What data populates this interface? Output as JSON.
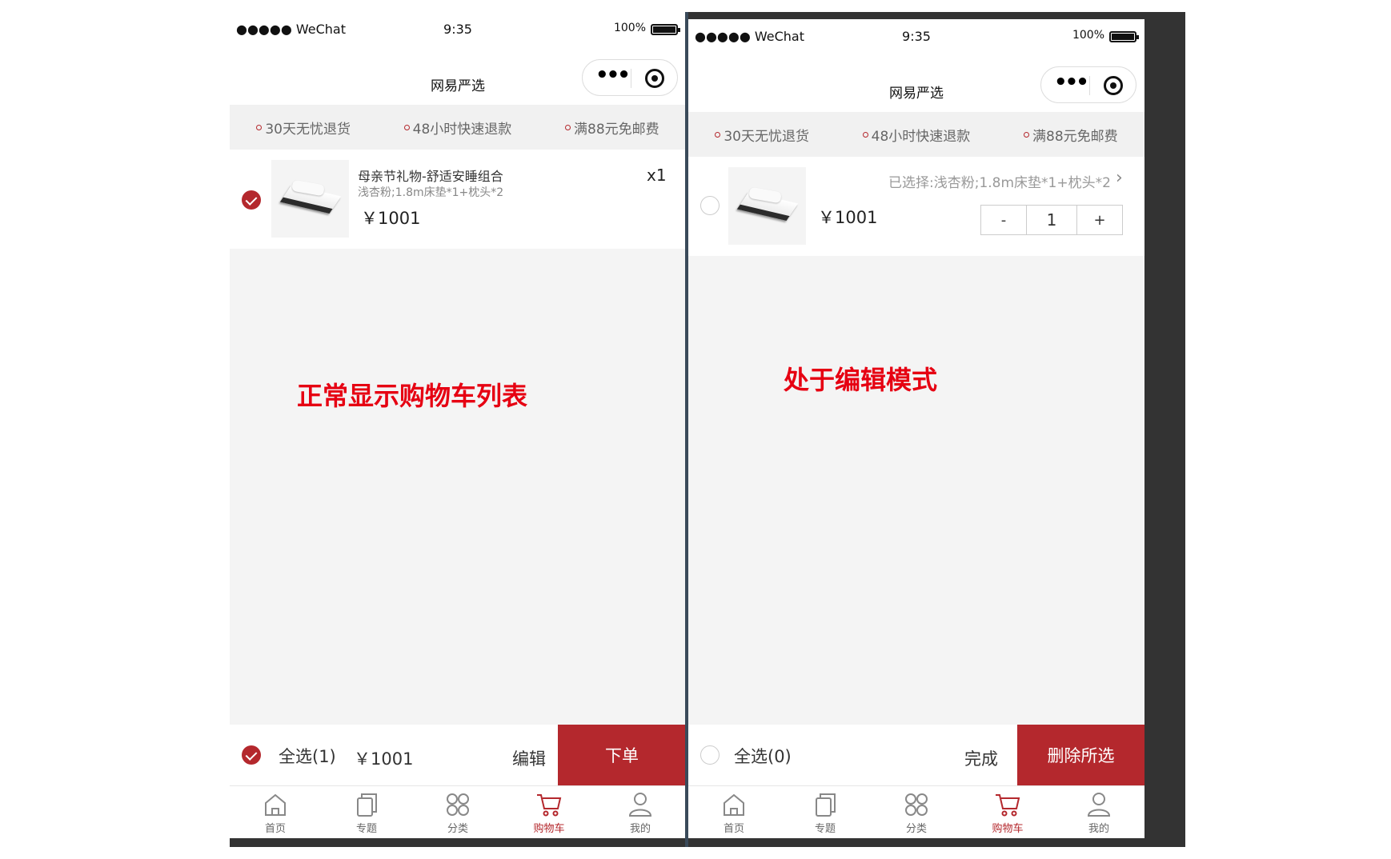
{
  "status_bar": {
    "carrier": "●●●●● WeChat",
    "time": "9:35",
    "battery": "100%"
  },
  "nav": {
    "title": "网易严选"
  },
  "services": [
    "30天无忧退货",
    "48小时快速退款",
    "满88元免邮费"
  ],
  "left": {
    "item": {
      "name": "母亲节礼物-舒适安睡组合",
      "spec": "浅杏粉;1.8m床垫*1+枕头*2",
      "price": "￥1001",
      "qty": "x1",
      "checked": true
    },
    "annotation": "正常显示购物车列表",
    "footer": {
      "select_all": "全选(1)",
      "total": "￥1001",
      "edit": "编辑",
      "action": "下单"
    }
  },
  "right": {
    "item": {
      "spec": "已选择:浅杏粉;1.8m床垫*1+枕头*2",
      "price": "￥1001",
      "stepper": {
        "minus": "-",
        "value": "1",
        "plus": "+"
      },
      "checked": false
    },
    "annotation": "处于编辑模式",
    "footer": {
      "select_all": "全选(0)",
      "done": "完成",
      "action": "删除所选"
    }
  },
  "tabs": [
    {
      "label": "首页",
      "icon": "home-icon"
    },
    {
      "label": "专题",
      "icon": "topic-icon"
    },
    {
      "label": "分类",
      "icon": "category-icon"
    },
    {
      "label": "购物车",
      "icon": "cart-icon",
      "active": true
    },
    {
      "label": "我的",
      "icon": "user-icon"
    }
  ],
  "colors": {
    "brand": "#b4282d",
    "annotation": "#e60012",
    "background": "#f4f4f4"
  }
}
